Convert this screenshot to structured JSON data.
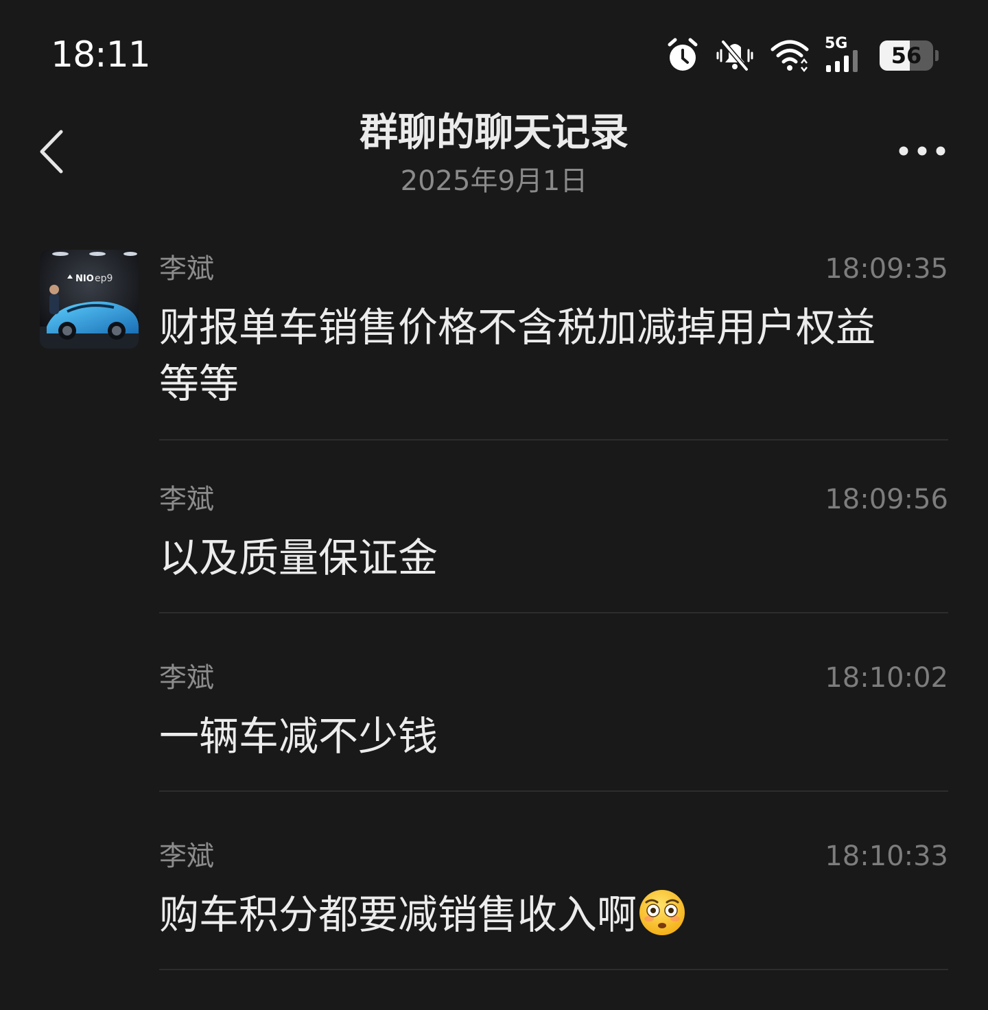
{
  "status_bar": {
    "time": "18:11",
    "network_label": "5G",
    "battery_level": "56",
    "battery_fraction": 0.56,
    "icons": [
      "alarm-icon",
      "mute-icon",
      "wifi-icon",
      "signal-icon",
      "battery-icon"
    ]
  },
  "header": {
    "title": "群聊的聊天记录",
    "date": "2025年9月1日",
    "back_icon": "chevron-left-icon",
    "more_icon": "more-dots-icon"
  },
  "avatar": {
    "logo_text": "NIO",
    "model_text": "ep9"
  },
  "messages": [
    {
      "sender": "李斌",
      "time": "18:09:35",
      "text": "财报单车销售价格不含税加减掉用户权益等等"
    },
    {
      "sender": "李斌",
      "time": "18:09:56",
      "text": "以及质量保证金"
    },
    {
      "sender": "李斌",
      "time": "18:10:02",
      "text": "一辆车减不少钱"
    },
    {
      "sender": "李斌",
      "time": "18:10:33",
      "text": "购车积分都要减销售收入啊",
      "emoji": "flushed-face-emoji"
    }
  ],
  "colors": {
    "background": "#191919",
    "divider": "#2d2d2d",
    "primary_text": "#ececec",
    "secondary_text": "#8c8c8c"
  }
}
